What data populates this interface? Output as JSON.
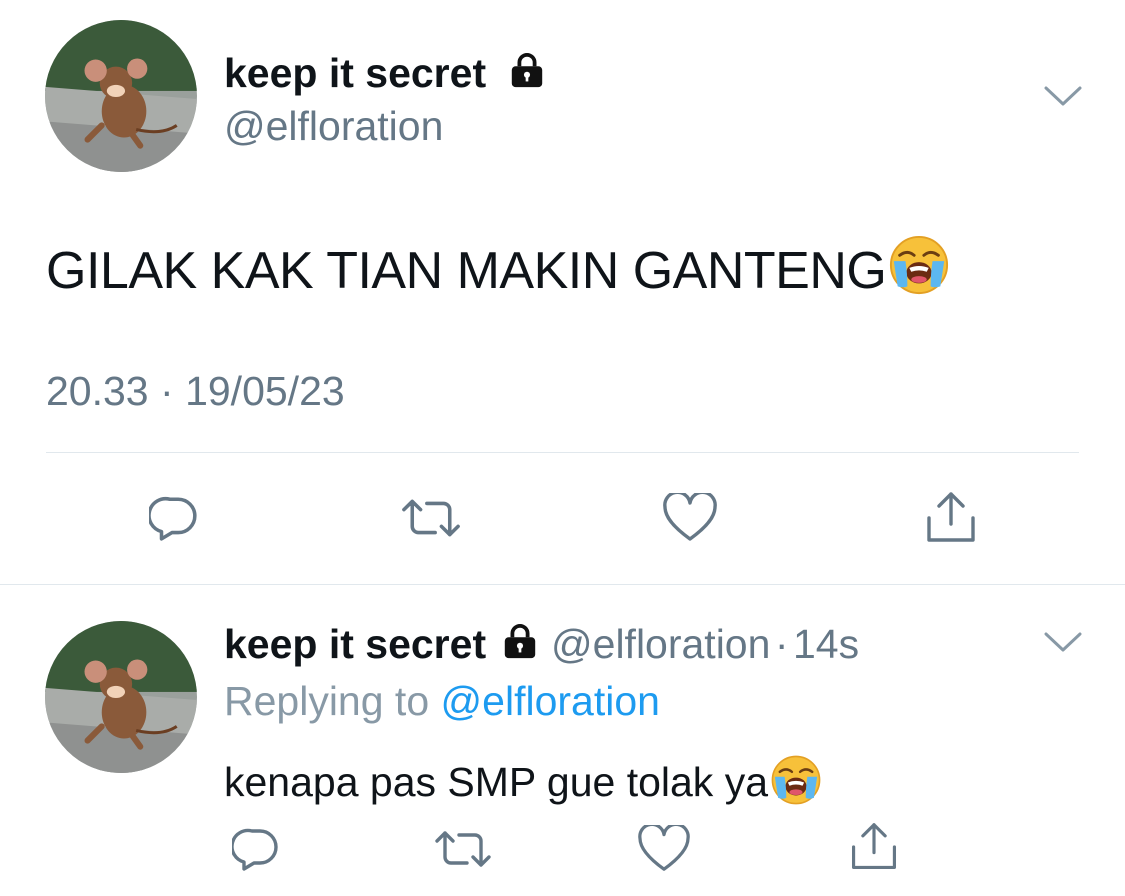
{
  "main_tweet": {
    "display_name": "keep it secret",
    "handle": "@elfloration",
    "text": "GILAK KAK TIAN MAKIN GANTENG",
    "emoji": "loudly-crying-face",
    "time": "20.33",
    "date": "19/05/23",
    "separator": "·"
  },
  "reply_tweet": {
    "display_name": "keep it secret",
    "handle": "@elfloration",
    "separator": "·",
    "time_ago": "14s",
    "replying_to_label": "Replying to",
    "replying_to_handle": "@elfloration",
    "text": "kenapa pas SMP gue tolak ya",
    "emoji": "loudly-crying-face"
  },
  "icons": {
    "verified_lock": "lock-icon",
    "more": "chevron-down-icon",
    "reply": "comment-icon",
    "retweet": "retweet-icon",
    "like": "heart-icon",
    "share": "share-icon"
  },
  "colors": {
    "text": "#0f1419",
    "secondary": "#657786",
    "link": "#1d9bf0",
    "divider": "#e1e8ed"
  }
}
